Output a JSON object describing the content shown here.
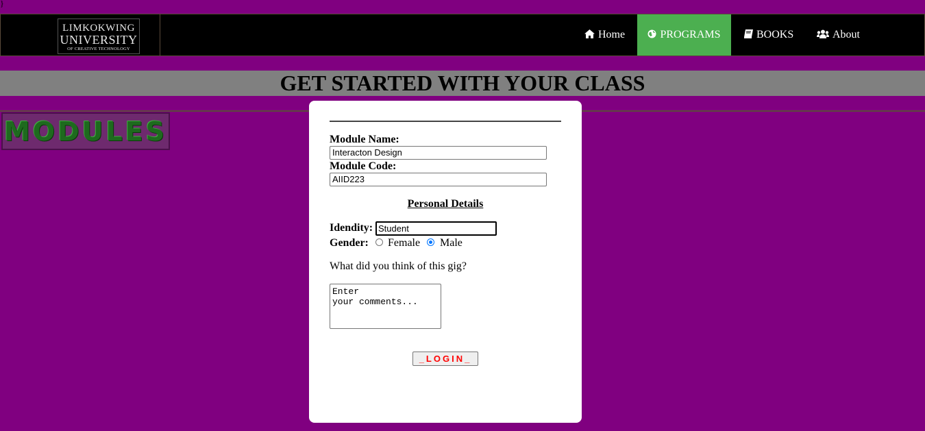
{
  "stray_text": "}",
  "logo": {
    "line1": "LIMKOKWING",
    "line2": "UNIVERSITY",
    "line3": "OF CREATIVE TECHNOLOGY"
  },
  "nav": {
    "items": [
      {
        "label": "Home",
        "icon": "home-icon",
        "active": false
      },
      {
        "label": "PROGRAMS",
        "icon": "globe-icon",
        "active": true
      },
      {
        "label": "BOOKS",
        "icon": "book-icon",
        "active": false
      },
      {
        "label": "About",
        "icon": "users-icon",
        "active": false
      }
    ]
  },
  "banner": {
    "title": "GET STARTED WITH YOUR CLASS"
  },
  "modules_image": {
    "text": "MODULES"
  },
  "form": {
    "module_name_label": "Module Name:",
    "module_name_value": "Interacton Design",
    "module_code_label": "Module Code:",
    "module_code_value": "AIID223",
    "section_title": "Personal Details",
    "identity_label": "Idendity:",
    "identity_value": "Student",
    "gender_label": "Gender:",
    "gender_options": [
      "Female",
      "Male"
    ],
    "gender_selected": "Male",
    "question": "What did you think of this gig?",
    "comments_value": "Enter\nyour comments...",
    "submit_label": "_LOGIN_"
  },
  "colors": {
    "page_bg": "#800080",
    "nav_bg": "#000000",
    "nav_active": "#4caf50",
    "banner_bg": "#808080",
    "button_text": "#ff0000"
  }
}
